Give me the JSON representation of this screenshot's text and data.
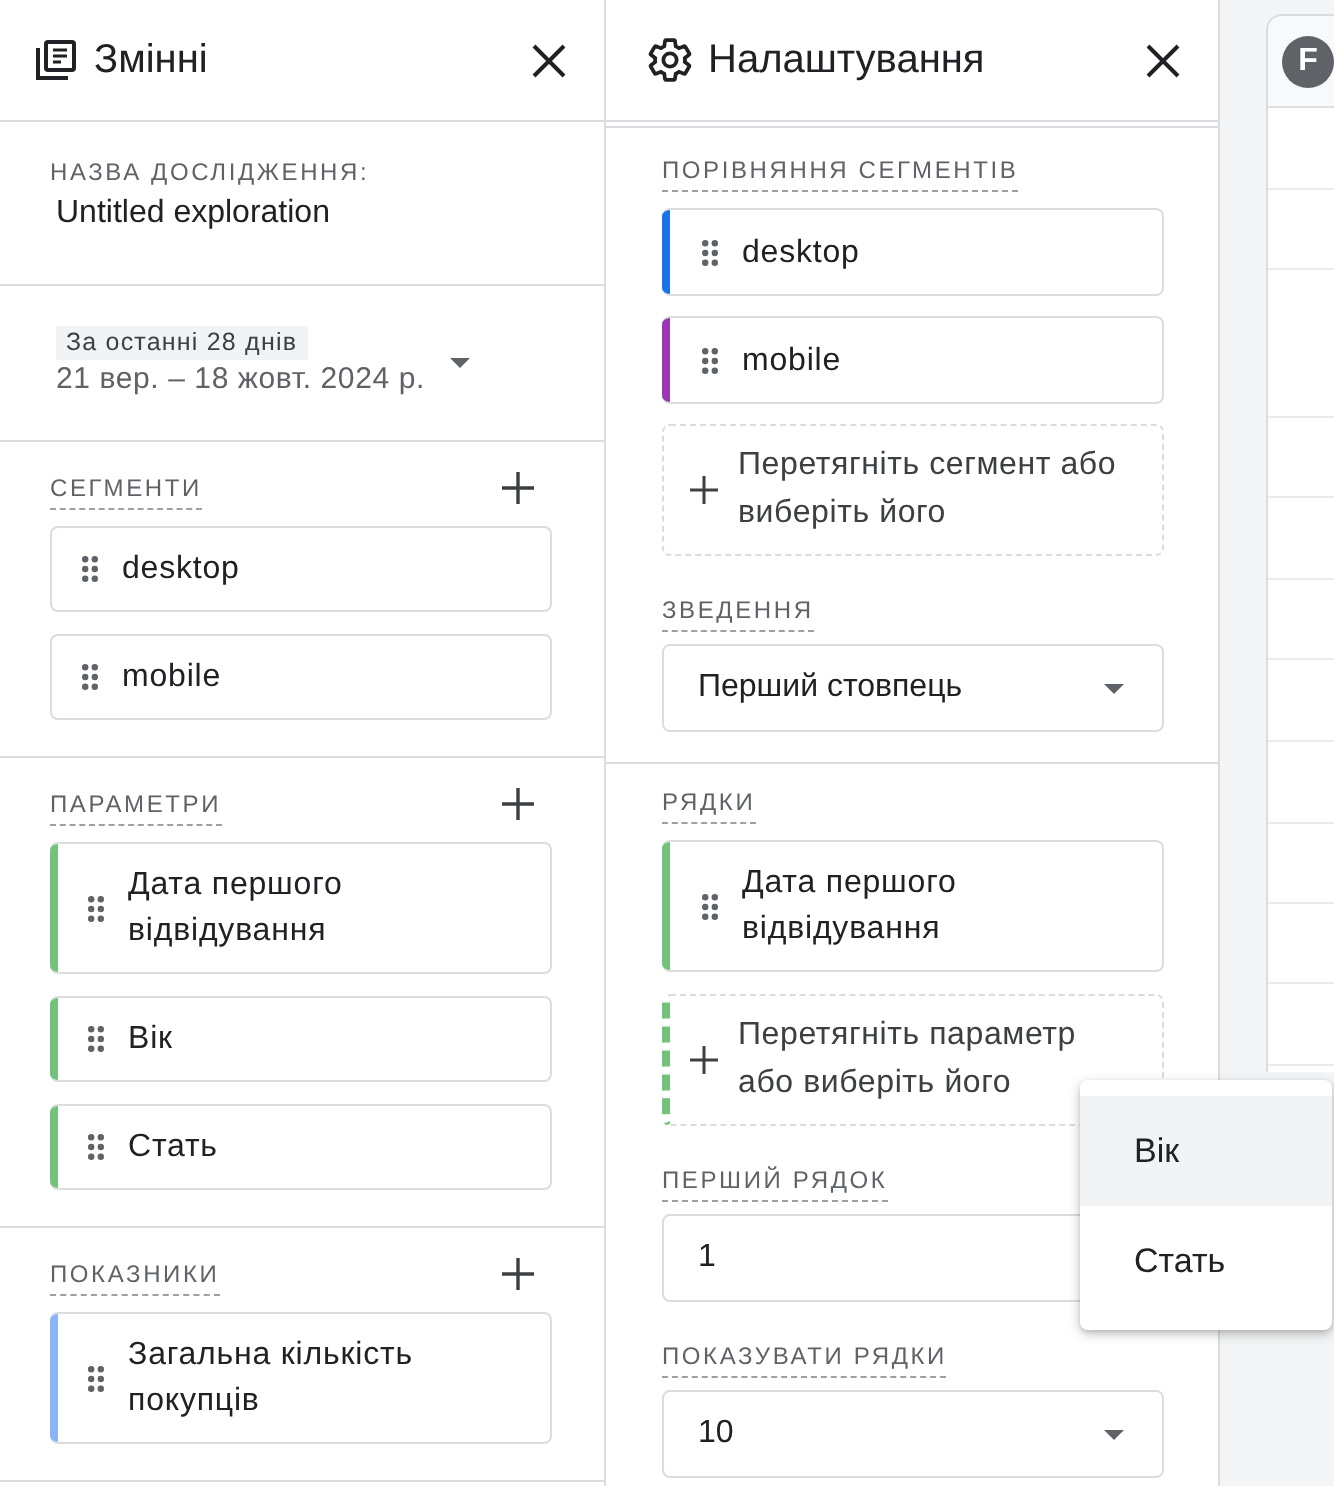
{
  "variables_panel": {
    "title": "Змінні",
    "exploration_name": {
      "label": "НАЗВА ДОСЛІДЖЕННЯ:",
      "value": "Untitled exploration"
    },
    "date_range": {
      "preset": "За останні 28 днів",
      "dates": "21 вер. – 18 жовт. 2024 р."
    },
    "sections": [
      {
        "kind": "segment",
        "label": "СЕГМЕНТИ",
        "items": [
          "desktop",
          "mobile"
        ]
      },
      {
        "kind": "dimension",
        "label": "ПАРАМЕТРИ",
        "items": [
          "Дата першого відвідування",
          "Вік",
          "Стать"
        ]
      },
      {
        "kind": "metric",
        "label": "ПОКАЗНИКИ",
        "items": [
          "Загальна кількість покупців"
        ]
      }
    ]
  },
  "settings_panel": {
    "title": "Налаштування",
    "segment_comparison": {
      "label": "ПОРІВНЯННЯ СЕГМЕНТІВ",
      "items": [
        {
          "name": "desktop",
          "color": "#1a73e8"
        },
        {
          "name": "mobile",
          "color": "#9c36b5"
        }
      ],
      "drop_hint": "Перетягніть сегмент або виберіть його"
    },
    "pivot": {
      "label": "ЗВЕДЕННЯ",
      "value": "Перший стовпець"
    },
    "rows": {
      "kind": "dimension",
      "label": "РЯДКИ",
      "items": [
        "Дата першого відвідування"
      ],
      "drop_hint": "Перетягніть параметр або виберіть його"
    },
    "start_row": {
      "label": "ПЕРШИЙ РЯДОК",
      "value": "1"
    },
    "show_rows": {
      "label": "ПОКАЗУВАТИ РЯДКИ",
      "value": "10"
    }
  },
  "dropdown_menu": {
    "items": [
      {
        "label": "Вік",
        "selected": true
      },
      {
        "label": "Стать",
        "selected": false
      }
    ]
  },
  "table_preview": {
    "avatar": "F"
  }
}
